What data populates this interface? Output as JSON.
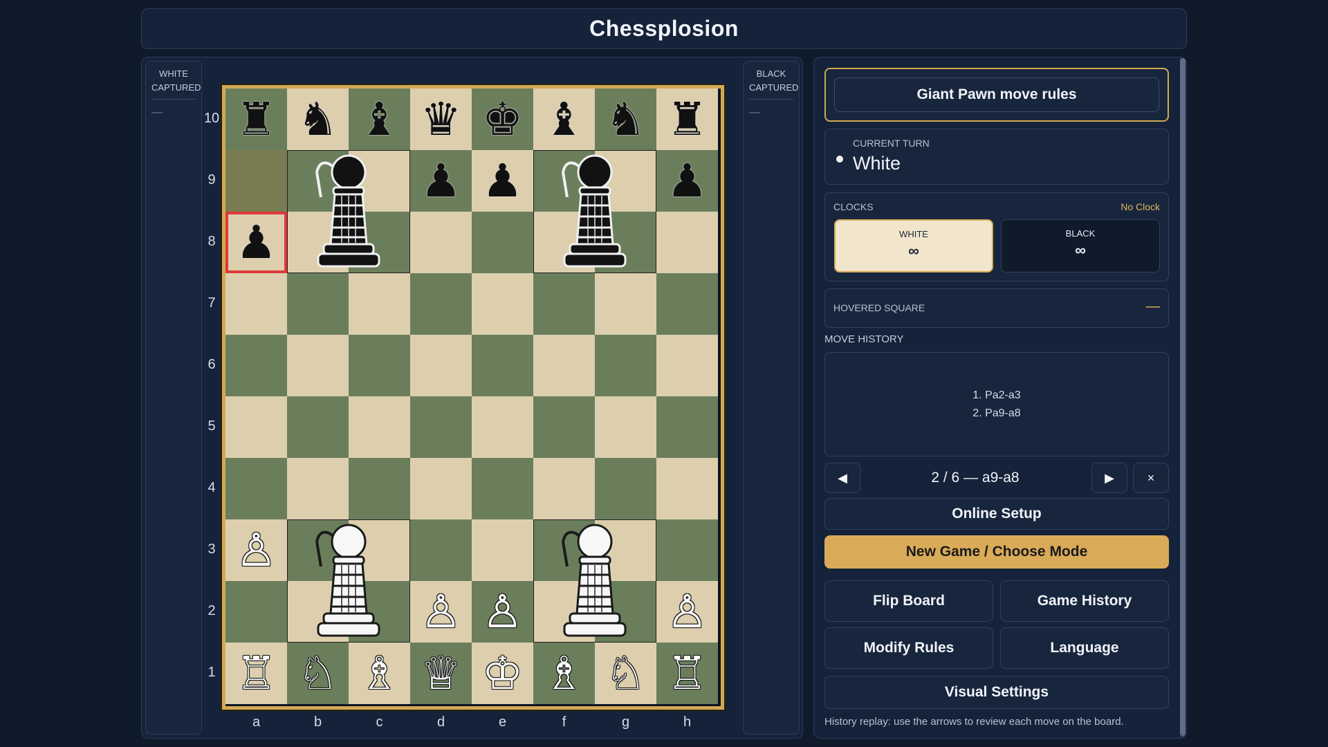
{
  "app": {
    "title": "Chessplosion"
  },
  "captured": {
    "white": {
      "label_line1": "WHITE",
      "label_line2": "CAPTURED",
      "empty": "—"
    },
    "black": {
      "label_line1": "BLACK",
      "label_line2": "CAPTURED",
      "empty": "—"
    }
  },
  "board": {
    "files": [
      "a",
      "b",
      "c",
      "d",
      "e",
      "f",
      "g",
      "h"
    ],
    "ranks": [
      "10",
      "9",
      "8",
      "7",
      "6",
      "5",
      "4",
      "3",
      "2",
      "1"
    ],
    "selected_square": "a8",
    "last_from_square": "a9",
    "pieces": [
      {
        "sq": "a10",
        "p": "♜",
        "c": "b"
      },
      {
        "sq": "b10",
        "p": "♞",
        "c": "b"
      },
      {
        "sq": "c10",
        "p": "♝",
        "c": "b"
      },
      {
        "sq": "d10",
        "p": "♛",
        "c": "b"
      },
      {
        "sq": "e10",
        "p": "♚",
        "c": "b"
      },
      {
        "sq": "f10",
        "p": "♝",
        "c": "b"
      },
      {
        "sq": "g10",
        "p": "♞",
        "c": "b"
      },
      {
        "sq": "h10",
        "p": "♜",
        "c": "b"
      },
      {
        "sq": "d9",
        "p": "♟",
        "c": "b"
      },
      {
        "sq": "e9",
        "p": "♟",
        "c": "b"
      },
      {
        "sq": "h9",
        "p": "♟",
        "c": "b"
      },
      {
        "sq": "a8",
        "p": "♟",
        "c": "b"
      },
      {
        "sq": "a3",
        "p": "♙",
        "c": "w"
      },
      {
        "sq": "d2",
        "p": "♙",
        "c": "w"
      },
      {
        "sq": "e2",
        "p": "♙",
        "c": "w"
      },
      {
        "sq": "h2",
        "p": "♙",
        "c": "w"
      },
      {
        "sq": "a1",
        "p": "♖",
        "c": "w"
      },
      {
        "sq": "b1",
        "p": "♘",
        "c": "w"
      },
      {
        "sq": "c1",
        "p": "♗",
        "c": "w"
      },
      {
        "sq": "d1",
        "p": "♕",
        "c": "w"
      },
      {
        "sq": "e1",
        "p": "♔",
        "c": "w"
      },
      {
        "sq": "f1",
        "p": "♗",
        "c": "w"
      },
      {
        "sq": "g1",
        "p": "♘",
        "c": "w"
      },
      {
        "sq": "h1",
        "p": "♖",
        "c": "w"
      }
    ],
    "giant_pawns": [
      {
        "anchor": "b9",
        "c": "b"
      },
      {
        "anchor": "f9",
        "c": "b"
      },
      {
        "anchor": "b3",
        "c": "w"
      },
      {
        "anchor": "f3",
        "c": "w"
      }
    ]
  },
  "rules": {
    "button_label": "Giant Pawn move rules"
  },
  "turn": {
    "label": "CURRENT TURN",
    "value": "White"
  },
  "clocks": {
    "label": "CLOCKS",
    "mode": "No Clock",
    "white": {
      "name": "WHITE",
      "time": "∞"
    },
    "black": {
      "name": "BLACK",
      "time": "∞"
    }
  },
  "hovered": {
    "label": "HOVERED SQUARE",
    "value": "—"
  },
  "history": {
    "title": "MOVE HISTORY",
    "moves": [
      "1. Pa2-a3",
      "2. Pa9-a8"
    ],
    "position": "2 / 6 — a9-a8",
    "prev": "◀",
    "next": "▶",
    "close": "×"
  },
  "buttons": {
    "online_setup": "Online Setup",
    "new_game": "New Game / Choose Mode",
    "flip_board": "Flip Board",
    "game_history": "Game History",
    "modify_rules": "Modify Rules",
    "language": "Language",
    "visual_settings": "Visual Settings"
  },
  "hint": "History replay: use the arrows to review each move on the board.",
  "colors": {
    "accent": "#d9ab58",
    "selected": "#e0383b",
    "light_square": "#ddcfae",
    "dark_square": "#6a7e5c"
  }
}
